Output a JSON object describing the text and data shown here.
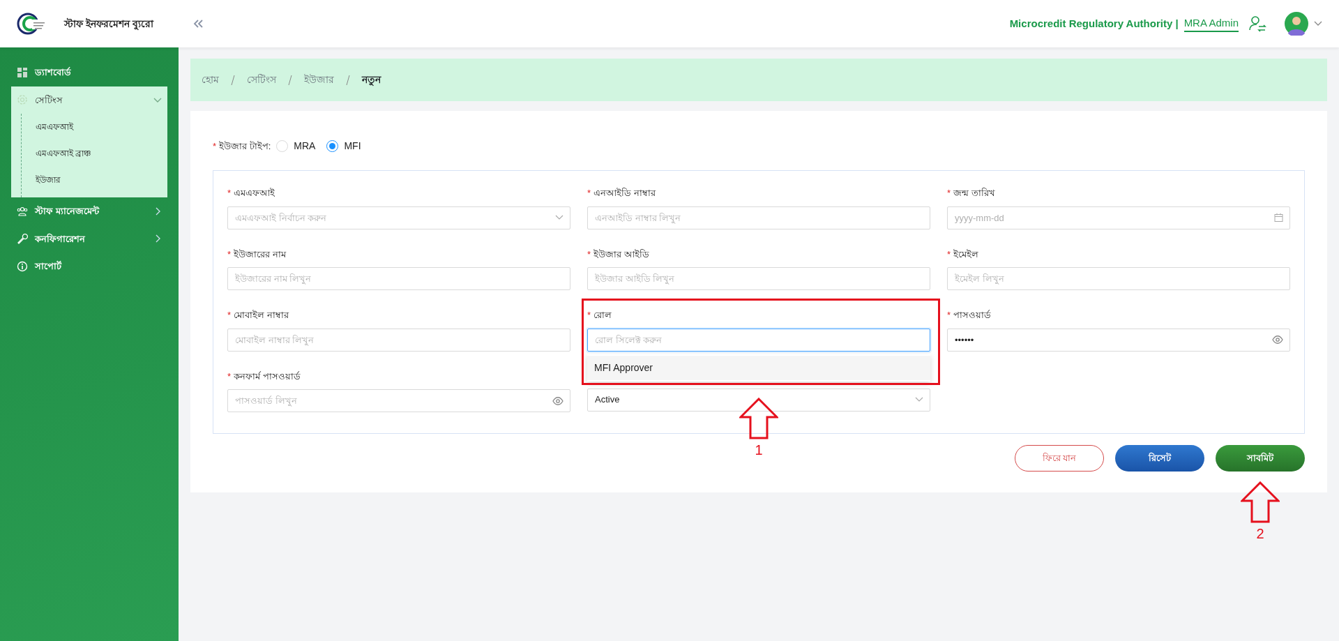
{
  "header": {
    "app_title": "স্টাফ ইনফরমেশন ব্যুরো",
    "org": "Microcredit Regulatory Authority |",
    "user": "MRA Admin"
  },
  "sidebar": {
    "items": [
      {
        "label": "ড্যাশবোর্ড",
        "kind": "link"
      },
      {
        "label": "সেটিংস",
        "kind": "group",
        "expanded": true,
        "children": [
          {
            "label": "এমএফআই"
          },
          {
            "label": "এমএফআই ব্রাঞ্চ"
          },
          {
            "label": "ইউজার"
          }
        ]
      },
      {
        "label": "স্টাফ ম্যানেজমেন্ট",
        "kind": "group",
        "expanded": false
      },
      {
        "label": "কনফিগারেশন",
        "kind": "group",
        "expanded": false
      },
      {
        "label": "সাপোর্ট",
        "kind": "link"
      }
    ]
  },
  "breadcrumb": [
    "হোম",
    "সেটিংস",
    "ইউজার",
    "নতুন"
  ],
  "user_type": {
    "required_mark": "*",
    "label": "ইউজার টাইপ:",
    "options": [
      {
        "label": "MRA",
        "selected": false
      },
      {
        "label": "MFI",
        "selected": true
      }
    ]
  },
  "fields": [
    {
      "required_mark": "*",
      "label": "এমএফআই",
      "kind": "select",
      "placeholder": "এমএফআই নির্বাচন করুন"
    },
    {
      "required_mark": "*",
      "label": "এনআইডি নাম্বার",
      "kind": "text",
      "placeholder": "এনআইডি নাম্বার লিখুন"
    },
    {
      "required_mark": "*",
      "label": "জন্ম তারিখ",
      "kind": "date",
      "placeholder": "yyyy-mm-dd"
    },
    {
      "required_mark": "*",
      "label": "ইউজারের নাম",
      "kind": "text",
      "placeholder": "ইউজারের নাম লিখুন"
    },
    {
      "required_mark": "*",
      "label": "ইউজার আইডি",
      "kind": "text",
      "placeholder": "ইউজার আইডি লিখুন"
    },
    {
      "required_mark": "*",
      "label": "ইমেইল",
      "kind": "text",
      "placeholder": "ইমেইল লিখুন"
    },
    {
      "required_mark": "*",
      "label": "মোবাইল নাম্বার",
      "kind": "text",
      "placeholder": "মোবাইল নাম্বার লিখুন"
    },
    {
      "required_mark": "*",
      "label": "রোল",
      "kind": "combo",
      "placeholder": "রোল সিলেক্ট করুন",
      "focused": true,
      "options": [
        "MFI Approver"
      ],
      "annotation": "1"
    },
    {
      "required_mark": "*",
      "label": "পাসওয়ার্ড",
      "kind": "password",
      "value": "••••••"
    },
    {
      "required_mark": "*",
      "label": "কনফার্ম পাসওয়ার্ড",
      "kind": "password",
      "placeholder": "পাসওয়ার্ড লিখুন"
    },
    {
      "kind": "select",
      "value": "Active"
    }
  ],
  "buttons": [
    {
      "label": "ফিরে যান",
      "kind": "back"
    },
    {
      "label": "রিসেট",
      "kind": "reset"
    },
    {
      "label": "সাবমিট",
      "kind": "submit",
      "annotation": "2"
    }
  ]
}
